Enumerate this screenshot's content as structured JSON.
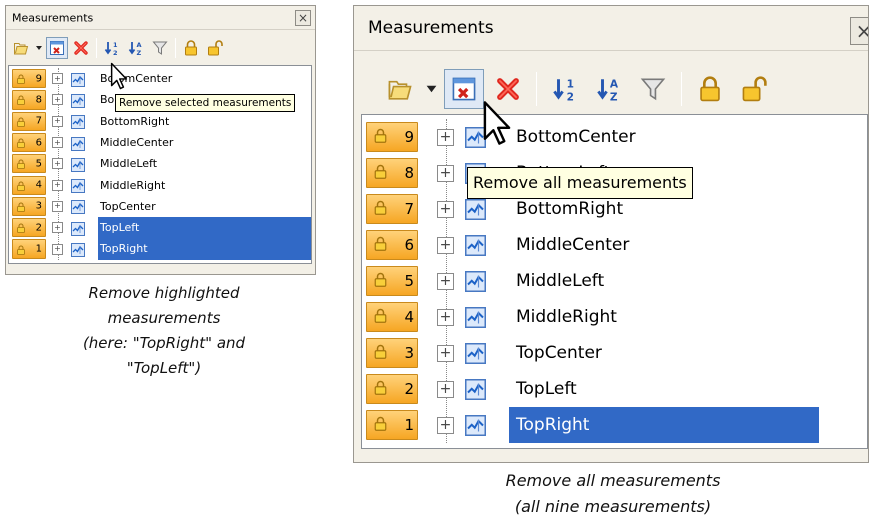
{
  "left": {
    "title": "Measurements",
    "close_icon": "×",
    "measurements": [
      {
        "num": "9",
        "name": "BottomCenter",
        "label_shown": "Bo    omCenter",
        "selected": false
      },
      {
        "num": "8",
        "name": "BottomLeft",
        "label_shown": "Bo",
        "selected": false
      },
      {
        "num": "7",
        "name": "BottomRight",
        "label_shown": "BottomRight",
        "selected": false
      },
      {
        "num": "6",
        "name": "MiddleCenter",
        "label_shown": "MiddleCenter",
        "selected": false
      },
      {
        "num": "5",
        "name": "MiddleLeft",
        "label_shown": "MiddleLeft",
        "selected": false
      },
      {
        "num": "4",
        "name": "MiddleRight",
        "label_shown": "MiddleRight",
        "selected": false
      },
      {
        "num": "3",
        "name": "TopCenter",
        "label_shown": "TopCenter",
        "selected": false
      },
      {
        "num": "2",
        "name": "TopLeft",
        "label_shown": "TopLeft",
        "selected": true
      },
      {
        "num": "1",
        "name": "TopRight",
        "label_shown": "TopRight",
        "selected": true
      }
    ],
    "tooltip": "Remove selected measurements",
    "caption": [
      "Remove highlighted",
      "measurements",
      "(here: \"TopRight\" and",
      "\"TopLeft\")"
    ]
  },
  "right": {
    "title": "Measurements",
    "close_icon": "×",
    "measurements": [
      {
        "num": "9",
        "name": "BottomCenter",
        "label_shown": "BottomCenter",
        "selected": false
      },
      {
        "num": "8",
        "name": "BottomLeft",
        "label_shown": "BottomLeft",
        "selected": false
      },
      {
        "num": "7",
        "name": "BottomRight",
        "label_shown": "BottomRight",
        "selected": false
      },
      {
        "num": "6",
        "name": "MiddleCenter",
        "label_shown": "MiddleCenter",
        "selected": false
      },
      {
        "num": "5",
        "name": "MiddleLeft",
        "label_shown": "MiddleLeft",
        "selected": false
      },
      {
        "num": "4",
        "name": "MiddleRight",
        "label_shown": "MiddleRight",
        "selected": false
      },
      {
        "num": "3",
        "name": "TopCenter",
        "label_shown": "TopCenter",
        "selected": false
      },
      {
        "num": "2",
        "name": "TopLeft",
        "label_shown": "TopLeft",
        "selected": false
      },
      {
        "num": "1",
        "name": "TopRight",
        "label_shown": "TopRight",
        "selected": true
      }
    ],
    "tooltip": "Remove all measurements",
    "caption": [
      "Remove all measurements",
      "(all nine measurements)"
    ]
  },
  "toolbar_icons": [
    "folder-icon",
    "dropdown-arrow-icon",
    "remove-all-measurements-icon",
    "remove-selected-measurements-icon",
    "sort-numeric-icon",
    "sort-alpha-icon",
    "filter-icon",
    "lock-icon",
    "unlock-icon"
  ],
  "colors": {
    "selection": "#3169c6",
    "lock_cell": "#f6a623",
    "tooltip_bg": "#ffffe1",
    "panel_bg": "#f3f0e7"
  }
}
